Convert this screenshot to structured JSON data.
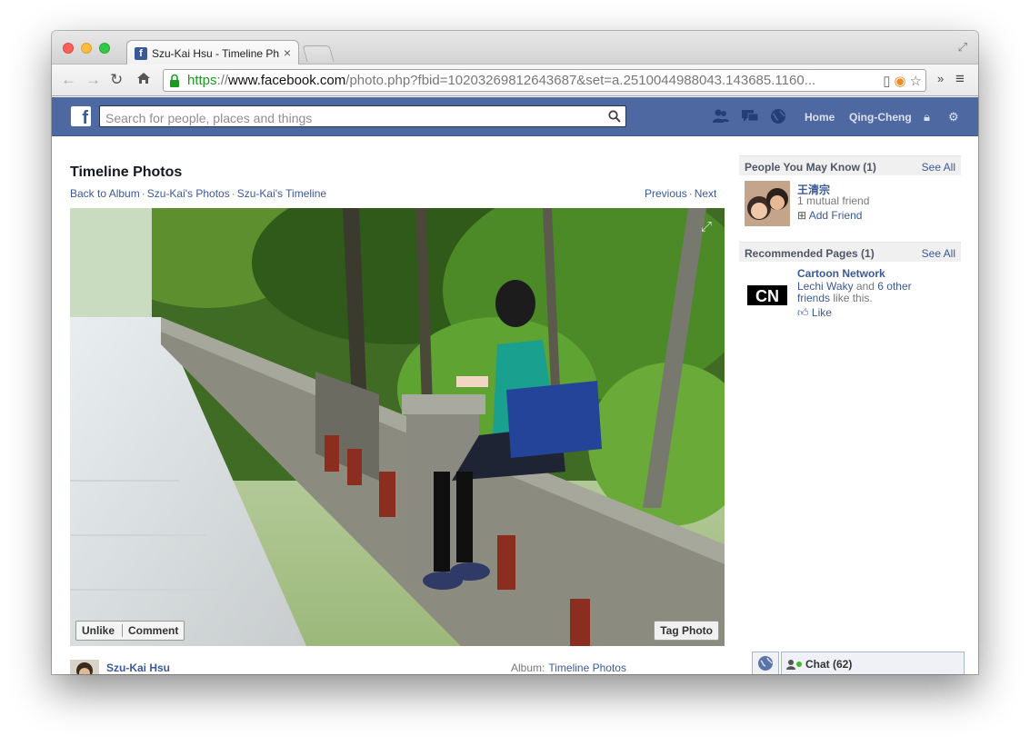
{
  "browser": {
    "tab_title": "Szu-Kai Hsu - Timeline Ph",
    "tab_close": "×",
    "url_scheme": "https",
    "url_sep": "://",
    "url_host": "www.facebook.com",
    "url_path": "/photo.php?fbid=10203269812643687&set=a.2510044988043.143685.1160...",
    "ext_chevron": "»",
    "menu_glyph": "≡"
  },
  "fb": {
    "logo": "f",
    "search_placeholder": "Search for people, places and things",
    "nav_home": "Home",
    "nav_user": "Qing-Cheng"
  },
  "page": {
    "title": "Timeline Photos",
    "breadcrumbs": [
      "Back to Album",
      "Szu-Kai's Photos",
      "Szu-Kai's Timeline"
    ],
    "breadcrumb_sep": "·",
    "prev": "Previous",
    "next": "Next",
    "unlike": "Unlike",
    "comment": "Comment",
    "tag_photo": "Tag Photo",
    "owner": "Szu-Kai Hsu",
    "album_label": "Album:",
    "album_name": "Timeline Photos"
  },
  "sidebar": {
    "pymk_title": "People You May Know (1)",
    "see_all": "See All",
    "person_name": "王清宗",
    "person_mutual": "1 mutual friend",
    "add_friend": "Add Friend",
    "rec_title": "Recommended Pages (1)",
    "page_name": "Cartoon Network",
    "liker1": "Lechi Waky",
    "and_text": " and ",
    "liker2": "6 other",
    "liker3": "friends",
    "like_this": " like this.",
    "like": "Like",
    "cn_logo_text": "CN"
  },
  "chat": {
    "label": "Chat (62)"
  }
}
